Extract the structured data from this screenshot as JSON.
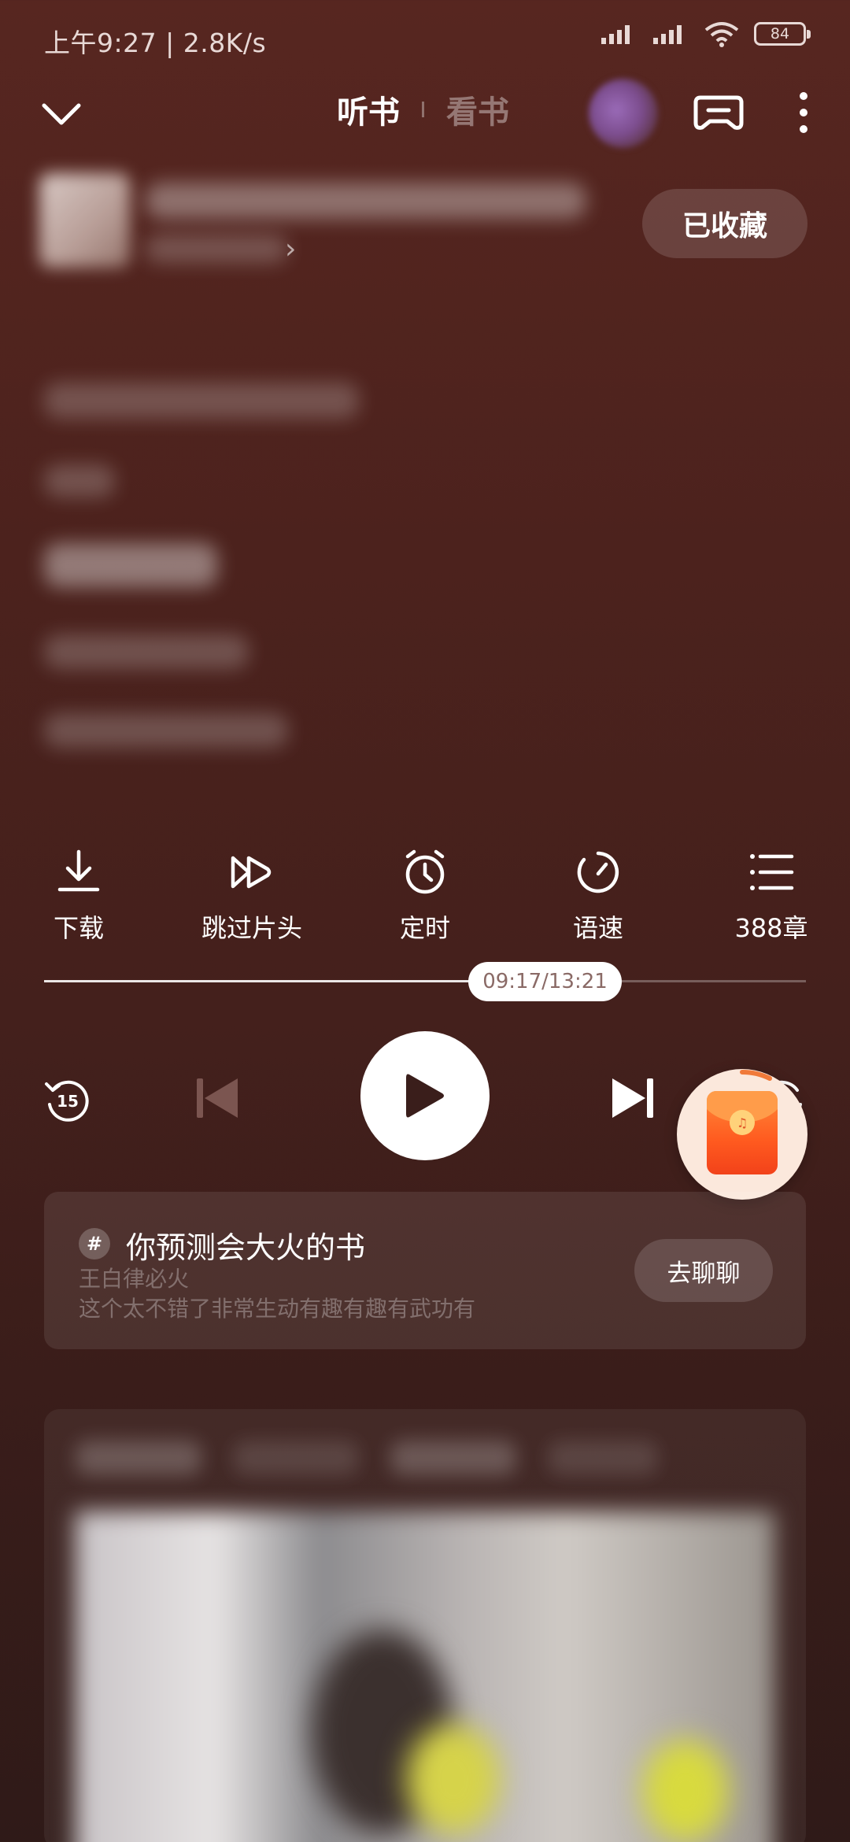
{
  "status_bar": {
    "time": "上午9:27 | 2.8K/s",
    "battery": "84"
  },
  "header": {
    "tab_listen": "听书",
    "tab_read": "看书",
    "collect_label": "已收藏"
  },
  "toolbar": {
    "download": "下载",
    "skip_intro": "跳过片头",
    "timer": "定时",
    "speed": "语速",
    "chapters": "388章"
  },
  "player": {
    "progress_text": "09:17/13:21",
    "progress_fraction": 0.694,
    "rewind_seconds": "15"
  },
  "topic": {
    "title": "你预测会大火的书",
    "line1": "王白律必火",
    "line2": "这个太不错了非常生动有趣有趣有武功有",
    "chat_label": "去聊聊"
  },
  "colors": {
    "background_top": "#572620",
    "background_bottom": "#2f1a18",
    "red_packet": "#ff5a1f"
  },
  "icons": [
    "chevron-down-icon",
    "gamepad-icon",
    "more-vertical-icon",
    "download-icon",
    "skip-forward-icon",
    "alarm-clock-icon",
    "speed-gauge-icon",
    "list-icon",
    "rewind-15-icon",
    "previous-icon",
    "play-icon",
    "next-icon",
    "forward-15-icon",
    "red-packet-icon",
    "hash-icon"
  ]
}
